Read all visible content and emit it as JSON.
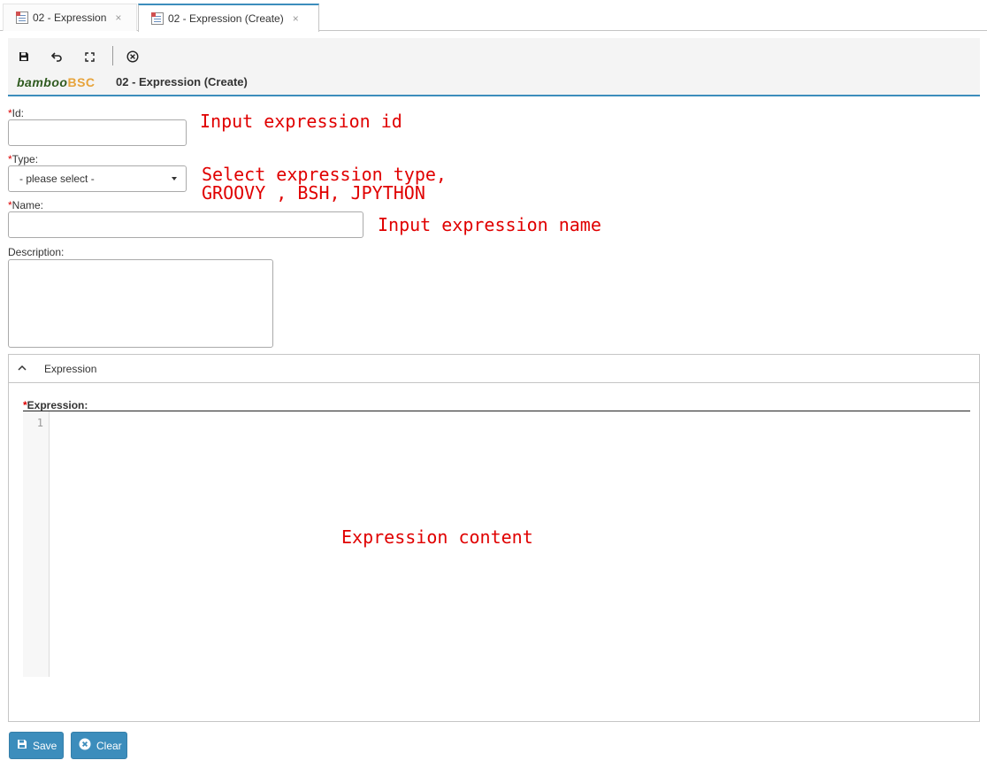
{
  "tabs": [
    {
      "label": "02 - Expression",
      "close": "×"
    },
    {
      "label": "02 - Expression (Create)",
      "close": "×"
    }
  ],
  "toolbar": {
    "brand_part1": "bamboo",
    "brand_part2": "BSC",
    "page_title": "02 - Expression (Create)"
  },
  "form": {
    "id_label": "Id:",
    "type_label": "Type:",
    "type_selected": "- please select -",
    "name_label": "Name:",
    "description_label": "Description:",
    "required_mark": "*"
  },
  "annotations": {
    "id_note": "Input expression id",
    "type_note_line1": "Select expression type,",
    "type_note_line2": "GROOVY , BSH, JPYTHON",
    "name_note": "Input expression name",
    "content_note": "Expression content"
  },
  "expression_panel": {
    "header": "Expression",
    "field_label": "Expression:",
    "line_number": "1"
  },
  "buttons": {
    "save": "Save",
    "clear": "Clear"
  }
}
